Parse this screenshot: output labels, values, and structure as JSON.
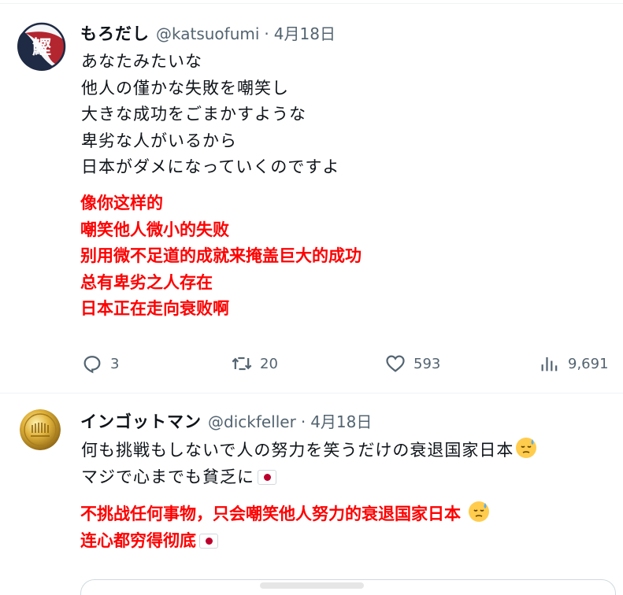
{
  "tweets": [
    {
      "display_name": "もろだし",
      "handle": "@katsuofumi",
      "separator": "·",
      "date": "4月18日",
      "avatar_text": "鰹",
      "body": [
        "あなたみたいな",
        "他人の僅かな失敗を嘲笑し",
        "大きな成功をごまかすような",
        "卑劣な人がいるから",
        "日本がダメになっていくのですよ"
      ],
      "translation": [
        "像你这样的",
        "嘲笑他人微小的失败",
        "别用微不足道的成就来掩盖巨大的成功",
        "总有卑劣之人存在",
        "日本正在走向衰败啊"
      ],
      "actions": {
        "replies": "3",
        "retweets": "20",
        "likes": "593",
        "views": "9,691"
      }
    },
    {
      "display_name": "インゴットマン",
      "handle": "@dickfeller",
      "separator": "·",
      "date": "4月18日",
      "body": [
        "何も挑戦もしないで人の努力を笑うだけの衰退国家日本",
        "マジで心までも貧乏に"
      ],
      "translation": [
        "不挑战任何事物，只会嘲笑他人努力的衰退国家日本",
        "连心都穷得彻底"
      ]
    }
  ],
  "icons": {
    "reply": "reply-icon",
    "retweet": "retweet-icon",
    "like": "heart-icon",
    "views": "views-icon",
    "emoji_sweat": "downcast-sweat-emoji",
    "flag": "japan-flag-emoji"
  },
  "colors": {
    "translation_text": "#ff0000",
    "secondary_text": "#536471",
    "primary_text": "#0f1419"
  }
}
